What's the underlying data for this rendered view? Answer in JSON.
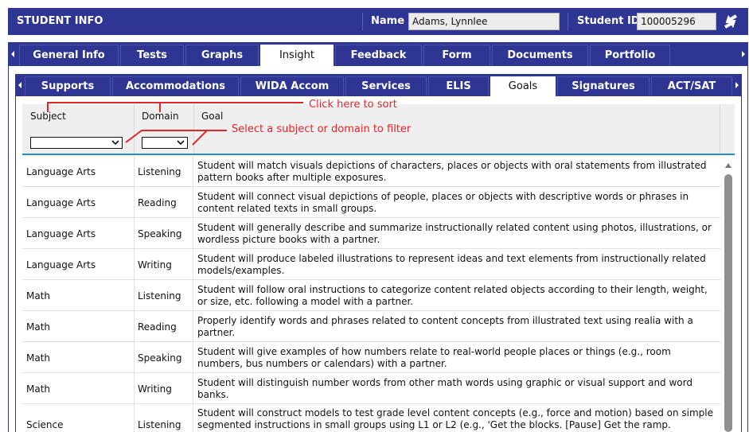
{
  "header": {
    "title": "STUDENT INFO",
    "name_label": "Name",
    "name_value": "Adams, Lynnlee",
    "id_label": "Student ID",
    "id_value": "100005296",
    "swap_icon": "swap-arrows-icon"
  },
  "main_tabs": [
    {
      "label": "General Info",
      "active": false
    },
    {
      "label": "Tests",
      "active": false
    },
    {
      "label": "Graphs",
      "active": false
    },
    {
      "label": "Insight",
      "active": true
    },
    {
      "label": "Feedback",
      "active": false
    },
    {
      "label": "Form",
      "active": false
    },
    {
      "label": "Documents",
      "active": false
    },
    {
      "label": "Portfolio",
      "active": false
    }
  ],
  "sub_tabs": [
    {
      "label": "Supports",
      "active": false
    },
    {
      "label": "Accommodations",
      "active": false
    },
    {
      "label": "WIDA Accom",
      "active": false
    },
    {
      "label": "Services",
      "active": false
    },
    {
      "label": "ELIS",
      "active": false
    },
    {
      "label": "Goals",
      "active": true
    },
    {
      "label": "Signatures",
      "active": false
    },
    {
      "label": "ACT/SAT",
      "active": false
    }
  ],
  "table": {
    "headers": {
      "subject": "Subject",
      "domain": "Domain",
      "goal": "Goal"
    },
    "subject_filter_value": "",
    "domain_filter_value": "",
    "rows": [
      {
        "subject": "Language Arts",
        "domain": "Listening",
        "goal": "Student will match visuals depictions of characters, places or objects with oral statements from illustrated pattern books after multiple exposures."
      },
      {
        "subject": "Language Arts",
        "domain": "Reading",
        "goal": "Student will connect visual depictions of people, places or objects with descriptive words or phrases in content related texts in small groups."
      },
      {
        "subject": "Language Arts",
        "domain": "Speaking",
        "goal": "Student will generally describe and summarize instructionally related content using photos, illustrations, or wordless picture books with a partner."
      },
      {
        "subject": "Language Arts",
        "domain": "Writing",
        "goal": "Student will produce labeled illustrations to represent ideas and text elements from instructionally related models/examples."
      },
      {
        "subject": "Math",
        "domain": "Listening",
        "goal": "Student will follow oral instructions to categorize content related objects according to their length, weight, or size, etc. following a model with a partner."
      },
      {
        "subject": "Math",
        "domain": "Reading",
        "goal": "Properly identify words and phrases related to content concepts from illustrated text using realia with a partner."
      },
      {
        "subject": "Math",
        "domain": "Speaking",
        "goal": "Student will give examples of how numbers relate to real-world people places or things (e.g., room numbers, bus numbers or calendars) with a partner."
      },
      {
        "subject": "Math",
        "domain": "Writing",
        "goal": "Student will distinguish number words from other math words using graphic or visual support and word banks."
      },
      {
        "subject": "Science",
        "domain": "Listening",
        "goal": "Student will construct models to test grade level content concepts (e.g., force and motion) based on simple segmented instructions in small groups using L1 or L2 (e.g., 'Get the blocks. [Pause] Get the ramp."
      }
    ]
  },
  "annotations": {
    "sort_hint": "Click here to sort",
    "filter_hint": "Select a subject or domain to filter"
  },
  "colors": {
    "accent": "#2e3593",
    "annotation": "#e3262a",
    "header_rule": "#2a8bd3"
  }
}
